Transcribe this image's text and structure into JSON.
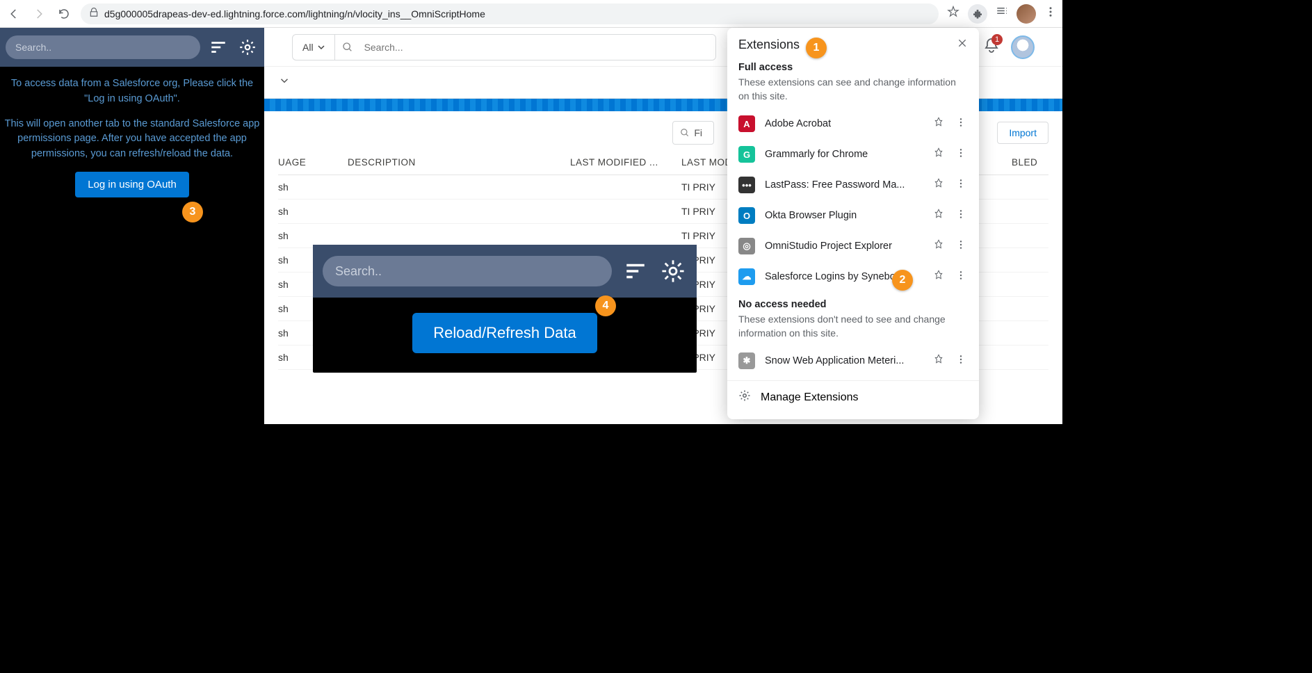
{
  "browser": {
    "url": "d5g000005drapeas-dev-ed.lightning.force.com/lightning/n/vlocity_ins__OmniScriptHome"
  },
  "leftPanel": {
    "searchPlaceholder": "Search..",
    "para1": "To access data from a Salesforce org, Please click the \"Log in using OAuth\".",
    "para2": "This will open another tab to the standard Salesforce app permissions page. After you have accepted the app permissions, you can refresh/reload the data.",
    "oauthBtn": "Log in using OAuth"
  },
  "floatPanel": {
    "searchPlaceholder": "Search..",
    "reloadBtn": "Reload/Refresh Data"
  },
  "salesforce": {
    "searchAll": "All",
    "searchPlaceholder": "Search...",
    "notificationCount": "1",
    "findPlaceholder": "Fi",
    "importBtn": "Import",
    "columns": {
      "lang": "UAGE",
      "desc": "DESCRIPTION",
      "lm1": "LAST MODIFIED ...",
      "lm2": "LAST MODIF",
      "enabled": "BLED"
    },
    "langCell": "sh",
    "modByCell": "TI PRIY"
  },
  "extPopup": {
    "title": "Extensions",
    "fullAccessTitle": "Full access",
    "fullAccessDesc": "These extensions can see and change information on this site.",
    "noAccessTitle": "No access needed",
    "noAccessDesc": "These extensions don't need to see and change information on this site.",
    "items": [
      {
        "name": "Adobe Acrobat",
        "bg": "#c8102e",
        "txt": "A"
      },
      {
        "name": "Grammarly for Chrome",
        "bg": "#15c39a",
        "txt": "G"
      },
      {
        "name": "LastPass: Free Password Ma...",
        "bg": "#333",
        "txt": "•••"
      },
      {
        "name": "Okta Browser Plugin",
        "bg": "#007dc1",
        "txt": "O"
      },
      {
        "name": "OmniStudio Project Explorer",
        "bg": "#888",
        "txt": "◎"
      },
      {
        "name": "Salesforce Logins by Synebo",
        "bg": "#1e9cef",
        "txt": "☁"
      }
    ],
    "noAccessItems": [
      {
        "name": "Snow Web Application Meteri...",
        "bg": "#999",
        "txt": "✱"
      }
    ],
    "manage": "Manage Extensions"
  },
  "annotations": {
    "a1": "1",
    "a2": "2",
    "a3": "3",
    "a4": "4"
  }
}
